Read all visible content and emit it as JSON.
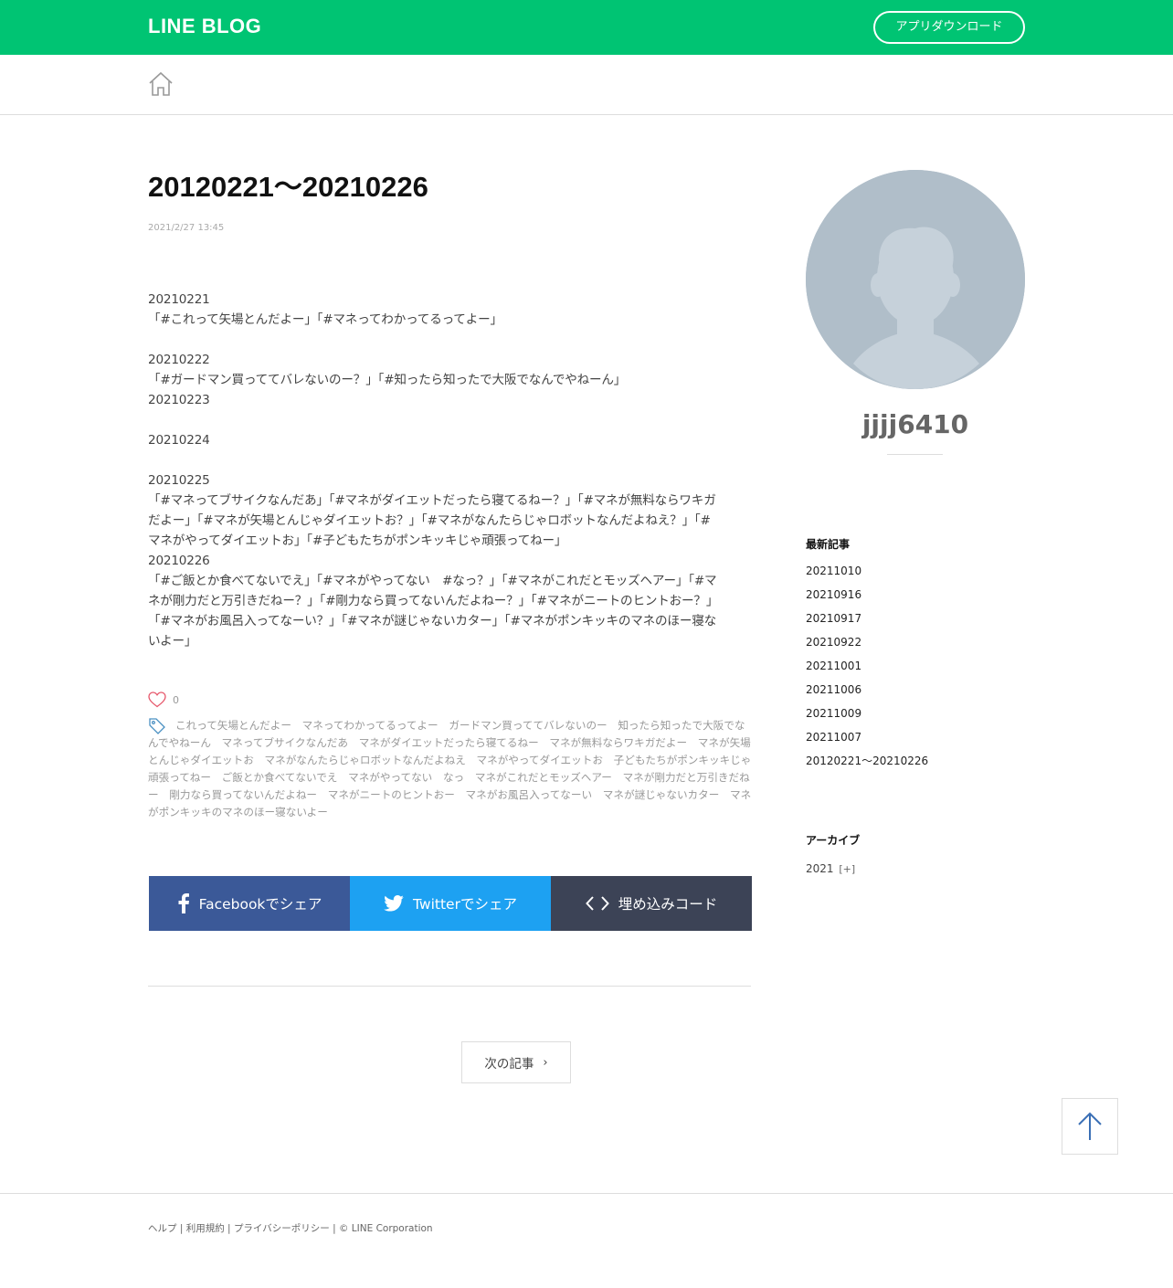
{
  "header": {
    "logo": "LINE BLOG",
    "download_label": "アプリダウンロード"
  },
  "article": {
    "title": "20120221〜20210226",
    "date": "2021/2/27 13:45",
    "body_lines": [
      "20210221",
      "「#これって矢場とんだよー」「#マネってわかってるってよー」",
      "",
      "20210222",
      "「#ガードマン買っててバレないのー？」「#知ったら知ったで大阪でなんでやねーん」",
      "20210223",
      "",
      "20210224",
      "",
      "20210225",
      "「#マネってブサイクなんだあ」「#マネがダイエットだったら寝てるねー？」「#マネが無料ならワキガ",
      "だよー」「#マネが矢場とんじゃダイエットお？」「#マネがなんたらじゃロボットなんだよねえ？」「#",
      "マネがやってダイエットお」「#子どもたちがポンキッキじゃ頑張ってねー」",
      "20210226",
      "「#ご飯とか食べてないでえ」「#マネがやってない　#なっ？」「#マネがこれだとモッズヘアー」「#マ",
      "ネが剛力だと万引きだねー？」「#剛力なら買ってないんだよねー？」「#マネがニートのヒントおー？」",
      "「#マネがお風呂入ってなーい？」「#マネが謎じゃないカター」「#マネがポンキッキのマネのほー寝な",
      "いよー」"
    ],
    "likes": "0",
    "tags": [
      "これって矢場とんだよー",
      "マネってわかってるってよー",
      "ガードマン買っててバレないのー",
      "知ったら知ったで大阪でなんでやねーん",
      "マネってブサイクなんだあ",
      "マネがダイエットだったら寝てるねー",
      "マネが無料ならワキガだよー",
      "マネが矢場とんじゃダイエットお",
      "マネがなんたらじゃロボットなんだよねえ",
      "マネがやってダイエットお",
      "子どもたちがポンキッキじゃ頑張ってねー",
      "ご飯とか食べてないでえ",
      "マネがやってない",
      "なっ",
      "マネがこれだとモッズヘアー",
      "マネが剛力だと万引きだねー",
      "剛力なら買ってないんだよねー",
      "マネがニートのヒントおー",
      "マネがお風呂入ってなーい",
      "マネが謎じゃないカター",
      "マネがポンキッキのマネのほー寝ないよー"
    ]
  },
  "share": {
    "facebook": "Facebookでシェア",
    "twitter": "Twitterでシェア",
    "embed": "埋め込みコード"
  },
  "pager": {
    "next": "次の記事"
  },
  "sidebar": {
    "username": "jjjj6410",
    "recent_heading": "最新記事",
    "recent": [
      "20211010",
      "20210916",
      "20210917",
      "20210922",
      "20211001",
      "20211006",
      "20211009",
      "20211007",
      "20120221〜20210226"
    ],
    "archive_heading": "アーカイブ",
    "archive_year": "2021",
    "archive_toggle": "[+]"
  },
  "footer": {
    "help": "ヘルプ",
    "terms": "利用規約",
    "privacy": "プライバシーポリシー",
    "copyright": "© LINE Corporation"
  },
  "colors": {
    "brand_green": "#00c473",
    "facebook": "#3b5998",
    "twitter": "#1da1f2",
    "embed": "#3c4356",
    "avatar_bg": "#b0bec9"
  }
}
